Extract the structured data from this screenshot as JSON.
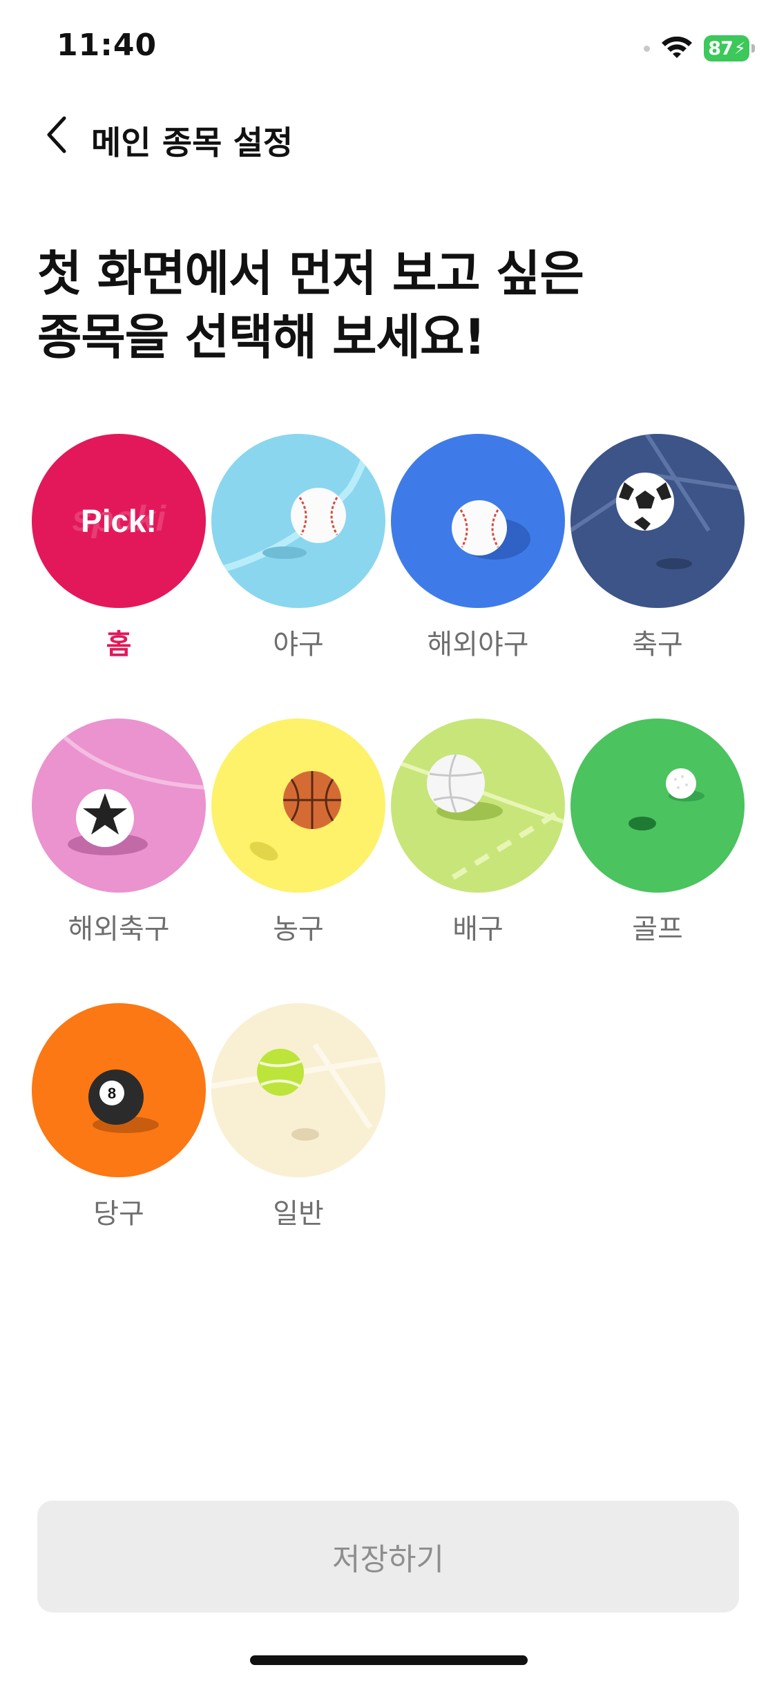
{
  "status_bar": {
    "time": "11:40",
    "battery": "87"
  },
  "nav": {
    "title": "메인 종목 설정",
    "back_icon": "chevron-left-icon"
  },
  "headline": {
    "line1": "첫 화면에서 먼저 보고 싶은",
    "line2": "종목을 선택해 보세요!"
  },
  "sports": [
    {
      "label": "홈",
      "color": "#e3185a",
      "icon": "pick-icon",
      "badge": "Pick!",
      "selected": true
    },
    {
      "label": "야구",
      "color": "#8ad6ee",
      "icon": "baseball-icon",
      "selected": false
    },
    {
      "label": "해외야구",
      "color": "#3f7be8",
      "icon": "baseball-icon",
      "selected": false
    },
    {
      "label": "축구",
      "color": "#3c5488",
      "icon": "soccer-ball-icon",
      "selected": false
    },
    {
      "label": "해외축구",
      "color": "#ea93cf",
      "icon": "star-soccer-ball-icon",
      "selected": false
    },
    {
      "label": "농구",
      "color": "#fdf26a",
      "icon": "basketball-icon",
      "selected": false
    },
    {
      "label": "배구",
      "color": "#c8e57a",
      "icon": "volleyball-icon",
      "selected": false
    },
    {
      "label": "골프",
      "color": "#4bc35f",
      "icon": "golf-ball-icon",
      "selected": false
    },
    {
      "label": "당구",
      "color": "#fb7814",
      "icon": "eight-ball-icon",
      "selected": false
    },
    {
      "label": "일반",
      "color": "#f9efd3",
      "icon": "tennis-ball-icon",
      "selected": false
    }
  ],
  "save_button": {
    "label": "저장하기"
  }
}
